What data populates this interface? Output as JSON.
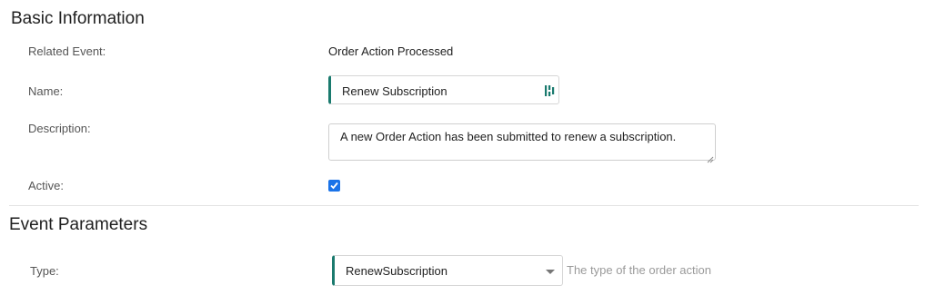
{
  "basic_info": {
    "title": "Basic Information",
    "related_event_label": "Related Event:",
    "related_event_value": "Order Action Processed",
    "name_label": "Name:",
    "name_value": "Renew Subscription",
    "name_icon": "translation-icon",
    "description_label": "Description:",
    "description_value": "A new Order Action has been submitted to renew a subscription.",
    "active_label": "Active:",
    "active_checked": true
  },
  "event_parameters": {
    "title": "Event Parameters",
    "type_label": "Type:",
    "type_value": "RenewSubscription",
    "type_hint": "The type of the order action"
  },
  "colors": {
    "accent_border": "#1a7a6e",
    "checkbox": "#1a73e8"
  }
}
